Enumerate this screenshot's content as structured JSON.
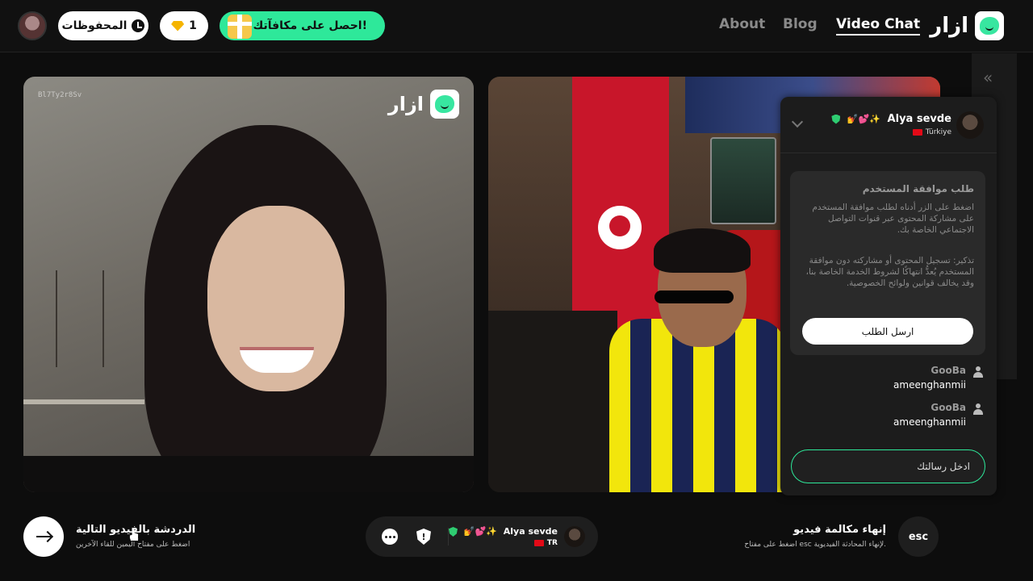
{
  "header": {
    "logo_text": "ازار",
    "nav": [
      {
        "label": "Video Chat",
        "active": true
      },
      {
        "label": "Blog",
        "active": false
      },
      {
        "label": "About",
        "active": false
      }
    ],
    "reward_label": "احصل على مكافآتك!",
    "gems_count": "1",
    "saved_label": "المحفوظات"
  },
  "videos": {
    "left": {
      "id_label": "Bl7Ty2r8Sv",
      "watermark": "ازار"
    },
    "right": {
      "watermark": "ازار"
    }
  },
  "chat": {
    "partner": {
      "name": "Alya sevde",
      "emojis": "💅💕✨",
      "country": "Türkiye"
    },
    "consent": {
      "title": "طلب موافقة المستخدم",
      "text1": "اضغط على الزر أدناه لطلب موافقة المستخدم على مشاركة المحتوى عبر قنوات التواصل الاجتماعي الخاصة بك.",
      "text2": "تذكير: تسجيل المحتوى أو مشاركته دون موافقة المستخدم يُعدُّ انتهاكًا لشروط الخدمة الخاصة بنا، وقد يخالف قوانين ولوائح الخصوصية.",
      "button": "ارسل الطلب"
    },
    "messages": [
      {
        "user": "GooBa",
        "text": "ameenghanmii"
      },
      {
        "user": "GooBa",
        "text": "ameenghanmii"
      }
    ],
    "input_placeholder": "ادخل رسالتك"
  },
  "bottom": {
    "next_title": "الدردشة بالفيديو التالية",
    "next_sub": "اضغط على مفتاح اليمين للقاء الآخرين",
    "partner_name": "Alya sevde",
    "partner_emojis": "💅💕✨",
    "partner_country": "TR",
    "end_title": "إنهاء مكالمة فيديو",
    "end_sub": "اضغط على مفتاح esc لإنهاء المحادثة الفيديوية.",
    "esc_label": "esc"
  },
  "colors": {
    "accent": "#2ee89a",
    "background": "#0d0d0d",
    "panel": "#1c1c1c"
  }
}
